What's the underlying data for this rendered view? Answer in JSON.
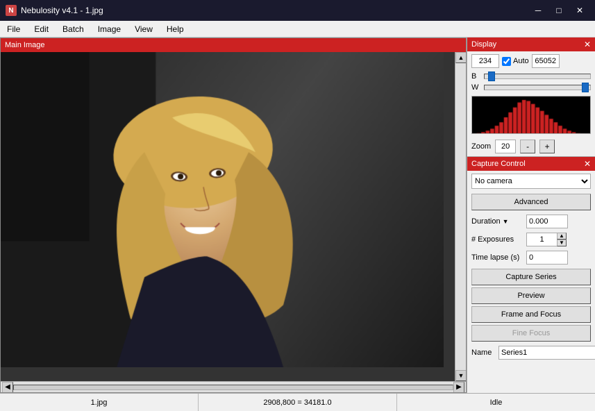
{
  "window": {
    "title": "Nebulosity v4.1 - 1.jpg",
    "icon": "N"
  },
  "titlebar": {
    "minimize": "─",
    "maximize": "□",
    "close": "✕"
  },
  "menubar": {
    "items": [
      "File",
      "Edit",
      "Batch",
      "Image",
      "View",
      "Help"
    ]
  },
  "imagePanel": {
    "header": "Main Image"
  },
  "display": {
    "sectionTitle": "Display",
    "blackPoint": "234",
    "whitePoint": "65052",
    "autoLabel": "Auto",
    "bLabel": "B",
    "wLabel": "W",
    "bThumbPercent": 5,
    "wThumbPercent": 95,
    "zoomLabel": "Zoom",
    "zoomValue": "20",
    "minusLabel": "-",
    "plusLabel": "+"
  },
  "capture": {
    "sectionTitle": "Capture Control",
    "cameraOptions": [
      "No camera"
    ],
    "selectedCamera": "No camera",
    "advancedBtn": "Advanced",
    "durationLabel": "Duration",
    "durationValue": "0.000",
    "exposuresLabel": "# Exposures",
    "exposuresValue": "1",
    "timeLapseLabel": "Time lapse (s)",
    "timeLapseValue": "0",
    "captureSeriesBtn": "Capture Series",
    "previewBtn": "Preview",
    "frameAndFocusBtn": "Frame and Focus",
    "fineFocusBtn": "Fine Focus",
    "nameLabel": "Name",
    "nameValue": "Series1"
  },
  "statusBar": {
    "filename": "1.jpg",
    "coordinates": "2908,800 = 34181.0",
    "status": "Idle"
  }
}
